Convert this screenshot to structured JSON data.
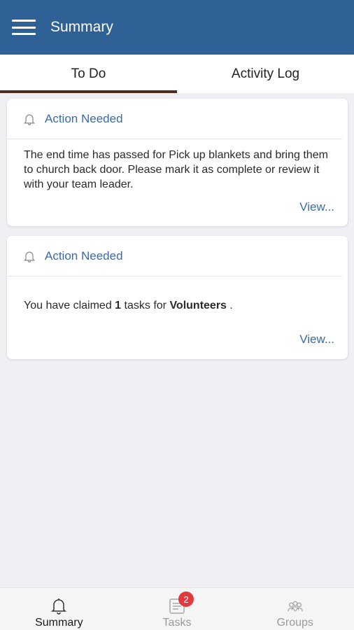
{
  "header": {
    "title": "Summary",
    "menu_icon": "hamburger-menu-icon"
  },
  "tabs": [
    {
      "label": "To Do",
      "active": true
    },
    {
      "label": "Activity Log",
      "active": false
    }
  ],
  "cards": [
    {
      "icon": "bell-icon",
      "heading": "Action Needed",
      "message": "The end time has passed for Pick up blankets and bring them to church back door. Please mark it as complete or review it with your team leader.",
      "link": "View..."
    },
    {
      "icon": "bell-icon",
      "heading": "Action Needed",
      "message_prefix": "You have claimed ",
      "message_count": "1",
      "message_middle": " tasks for ",
      "message_group": "Volunteers",
      "message_suffix": " .",
      "link": "View..."
    }
  ],
  "bottom_nav": [
    {
      "label": "Summary",
      "icon": "bell-icon",
      "active": true
    },
    {
      "label": "Tasks",
      "icon": "tasks-icon",
      "active": false,
      "badge": "2"
    },
    {
      "label": "Groups",
      "icon": "groups-icon",
      "active": false
    }
  ],
  "colors": {
    "app_bar": "#2f6197",
    "link": "#3b6aa0",
    "tab_indicator": "#4a2e22",
    "badge": "#e0393e",
    "background": "#efeff4"
  }
}
